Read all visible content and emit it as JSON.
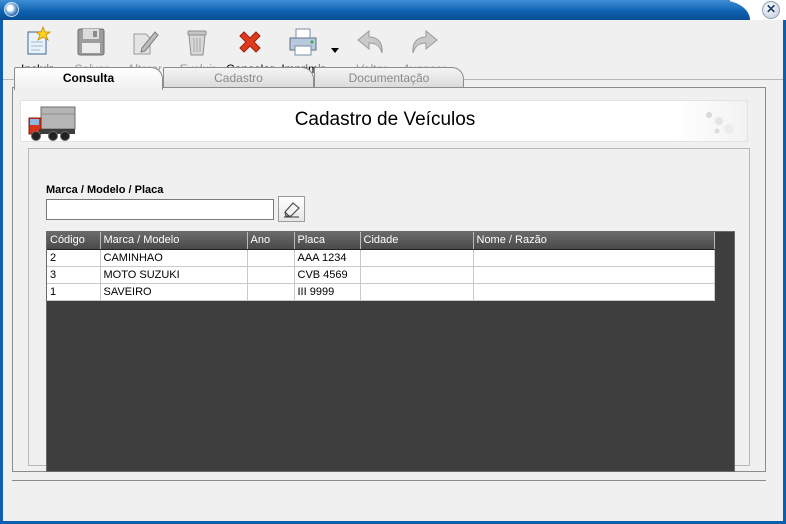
{
  "toolbar": {
    "buttons": [
      {
        "label": "Incluir",
        "icon": "new-document-star-icon",
        "enabled": true
      },
      {
        "label": "Salvar",
        "icon": "floppy-disk-icon",
        "enabled": false
      },
      {
        "label": "Alterar",
        "icon": "edit-pencil-icon",
        "enabled": false
      },
      {
        "label": "Excluir",
        "icon": "trash-can-icon",
        "enabled": false
      },
      {
        "label": "Cancelar",
        "icon": "red-x-icon",
        "enabled": true
      },
      {
        "label": "Imprimir",
        "icon": "printer-icon",
        "enabled": true
      },
      {
        "label": "Voltar",
        "icon": "arrow-back-icon",
        "enabled": false
      },
      {
        "label": "Avançar",
        "icon": "arrow-forward-icon",
        "enabled": false
      }
    ]
  },
  "tabs": [
    {
      "label": "Consulta",
      "active": true
    },
    {
      "label": "Cadastro",
      "active": false
    },
    {
      "label": "Documentação",
      "active": false
    }
  ],
  "header": {
    "title": "Cadastro de Veículos"
  },
  "search": {
    "label": "Marca / Modelo / Placa",
    "value": "",
    "placeholder": ""
  },
  "table": {
    "columns": [
      "Código",
      "Marca / Modelo",
      "Ano",
      "Placa",
      "Cidade",
      "Nome / Razão"
    ],
    "rows": [
      [
        "2",
        "CAMINHAO",
        "",
        "AAA 1234",
        "",
        ""
      ],
      [
        "3",
        "MOTO SUZUKI",
        "",
        "CVB 4569",
        "",
        ""
      ],
      [
        "1",
        "SAVEIRO",
        "",
        "III 9999",
        "",
        ""
      ]
    ]
  },
  "colors": {
    "titlebar": "#0b5fae",
    "grid_bg": "#3e3e3e",
    "accent_red": "#e03a1e"
  }
}
